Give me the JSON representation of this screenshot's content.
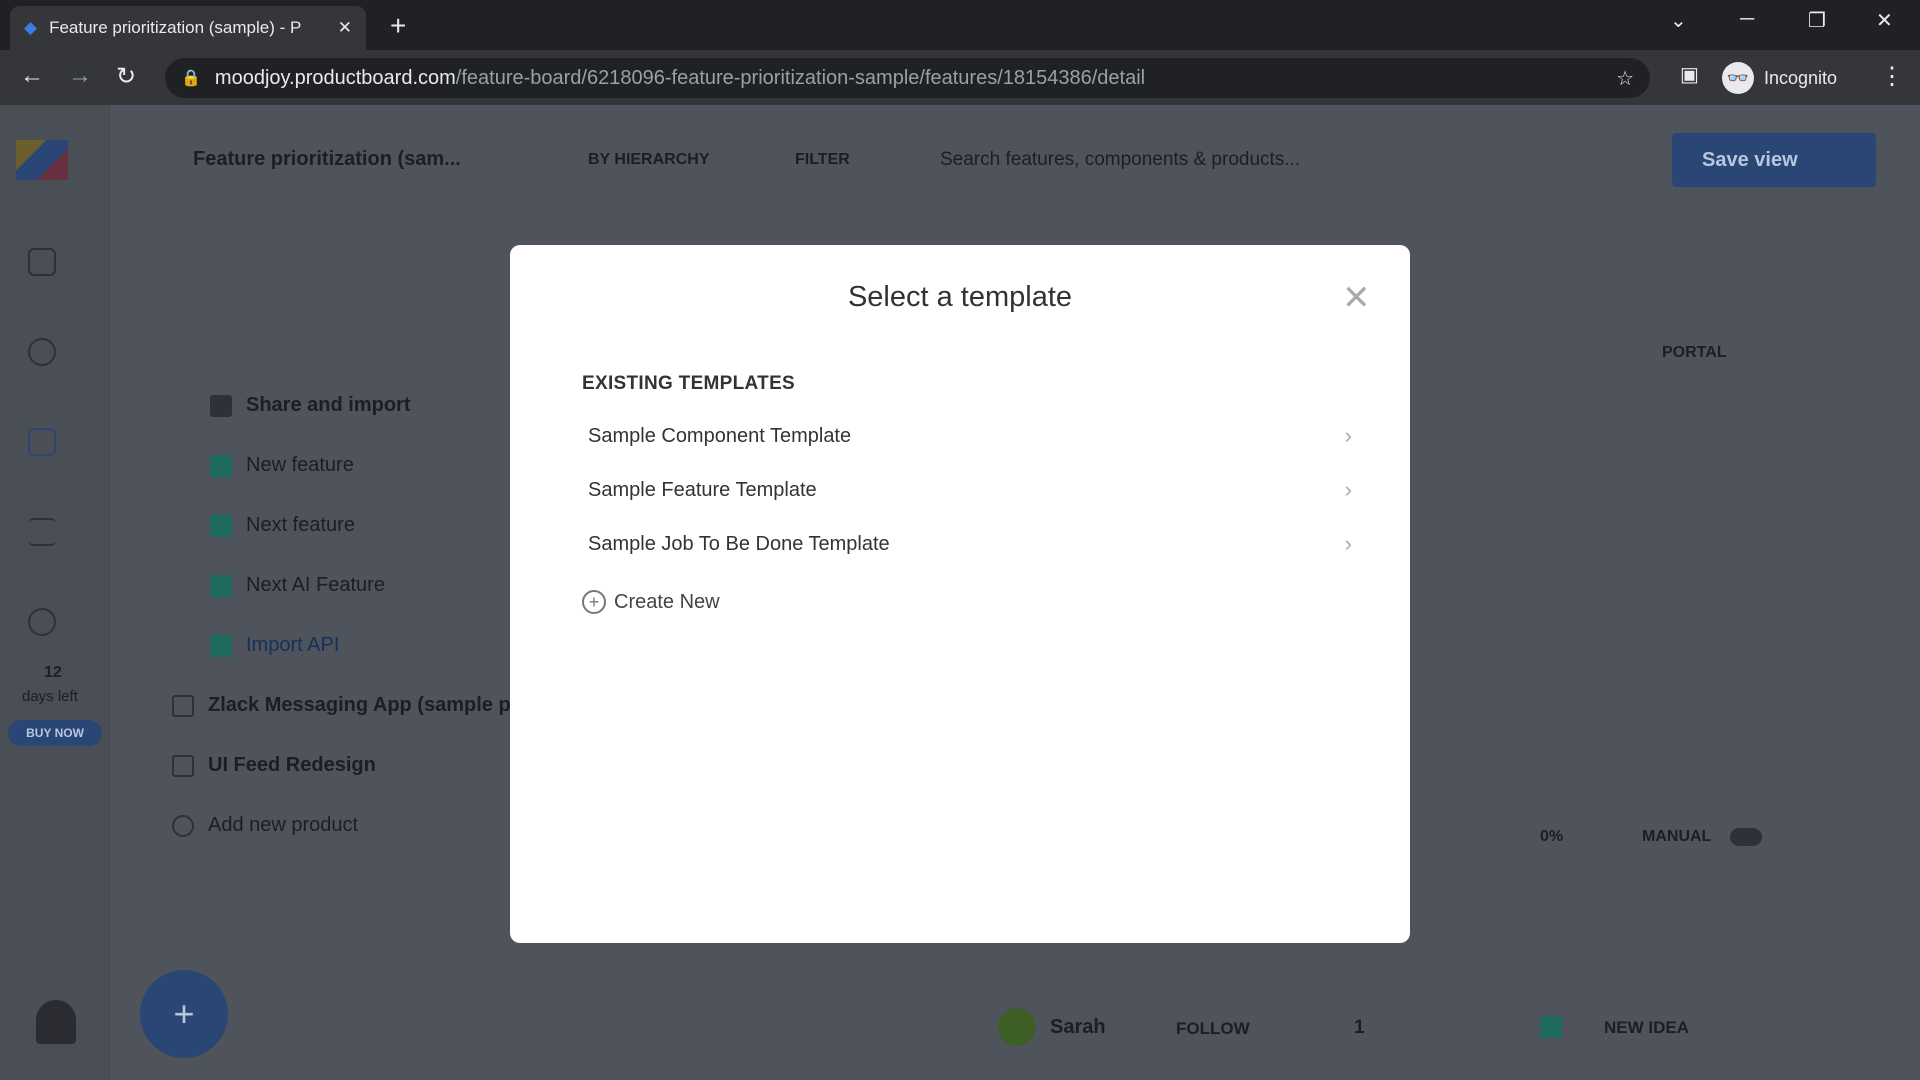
{
  "browser": {
    "tab_title": "Feature prioritization (sample) - P",
    "url_host": "moodjoy.productboard.com",
    "url_path": "/feature-board/6218096-feature-prioritization-sample/features/18154386/detail",
    "profile": "Incognito"
  },
  "app": {
    "board_title": "Feature prioritization (sam...",
    "group_by": "BY HIERARCHY",
    "filter": "FILTER",
    "search_placeholder": "Search features, components & products...",
    "save_view": "Save view",
    "trial_days": "12",
    "trial_label": "days left",
    "buy_now": "BUY NOW",
    "column_portal": "PORTAL",
    "tree": [
      {
        "label": "Share and import",
        "type": "component"
      },
      {
        "label": "New feature",
        "type": "feature"
      },
      {
        "label": "Next feature",
        "type": "feature"
      },
      {
        "label": "Next AI Feature",
        "type": "feature"
      },
      {
        "label": "Import API",
        "type": "feature"
      },
      {
        "label": "Zlack Messaging App (sample p",
        "type": "product"
      },
      {
        "label": "UI Feed Redesign",
        "type": "product"
      },
      {
        "label": "Add new product",
        "type": "action"
      }
    ],
    "progress": "0%",
    "manual": "MANUAL",
    "owner": "Sarah",
    "follow": "FOLLOW",
    "insights_count": "1",
    "new_idea": "NEW IDEA",
    "accent": "#3d7be0",
    "feature_color": "#21b29a"
  },
  "modal": {
    "title": "Select a template",
    "section_heading": "EXISTING TEMPLATES",
    "templates": [
      "Sample Component Template",
      "Sample Feature Template",
      "Sample Job To Be Done Template"
    ],
    "create_new": "Create New"
  }
}
